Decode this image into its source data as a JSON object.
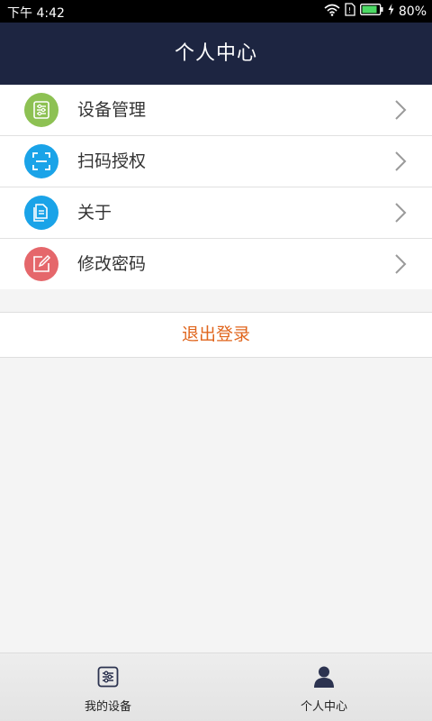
{
  "status_bar": {
    "time": "下午 4:42",
    "battery": "80%",
    "icons": [
      "wifi-icon",
      "sim-icon",
      "battery-icon",
      "charging-icon"
    ]
  },
  "header": {
    "title": "个人中心"
  },
  "menu": {
    "items": [
      {
        "label": "设备管理",
        "icon": "device-settings-icon",
        "color": "#8dc153"
      },
      {
        "label": "扫码授权",
        "icon": "scan-icon",
        "color": "#1aa3e8"
      },
      {
        "label": "关于",
        "icon": "document-icon",
        "color": "#1aa3e8"
      },
      {
        "label": "修改密码",
        "icon": "edit-icon",
        "color": "#e5676b"
      }
    ]
  },
  "logout": {
    "label": "退出登录",
    "color": "#e0661e"
  },
  "bottom_nav": {
    "tabs": [
      {
        "label": "我的设备",
        "icon": "sliders-icon",
        "active": false
      },
      {
        "label": "个人中心",
        "icon": "person-icon",
        "active": true
      }
    ]
  },
  "colors": {
    "header_bg": "#1d2541",
    "page_bg": "#f4f4f4"
  }
}
